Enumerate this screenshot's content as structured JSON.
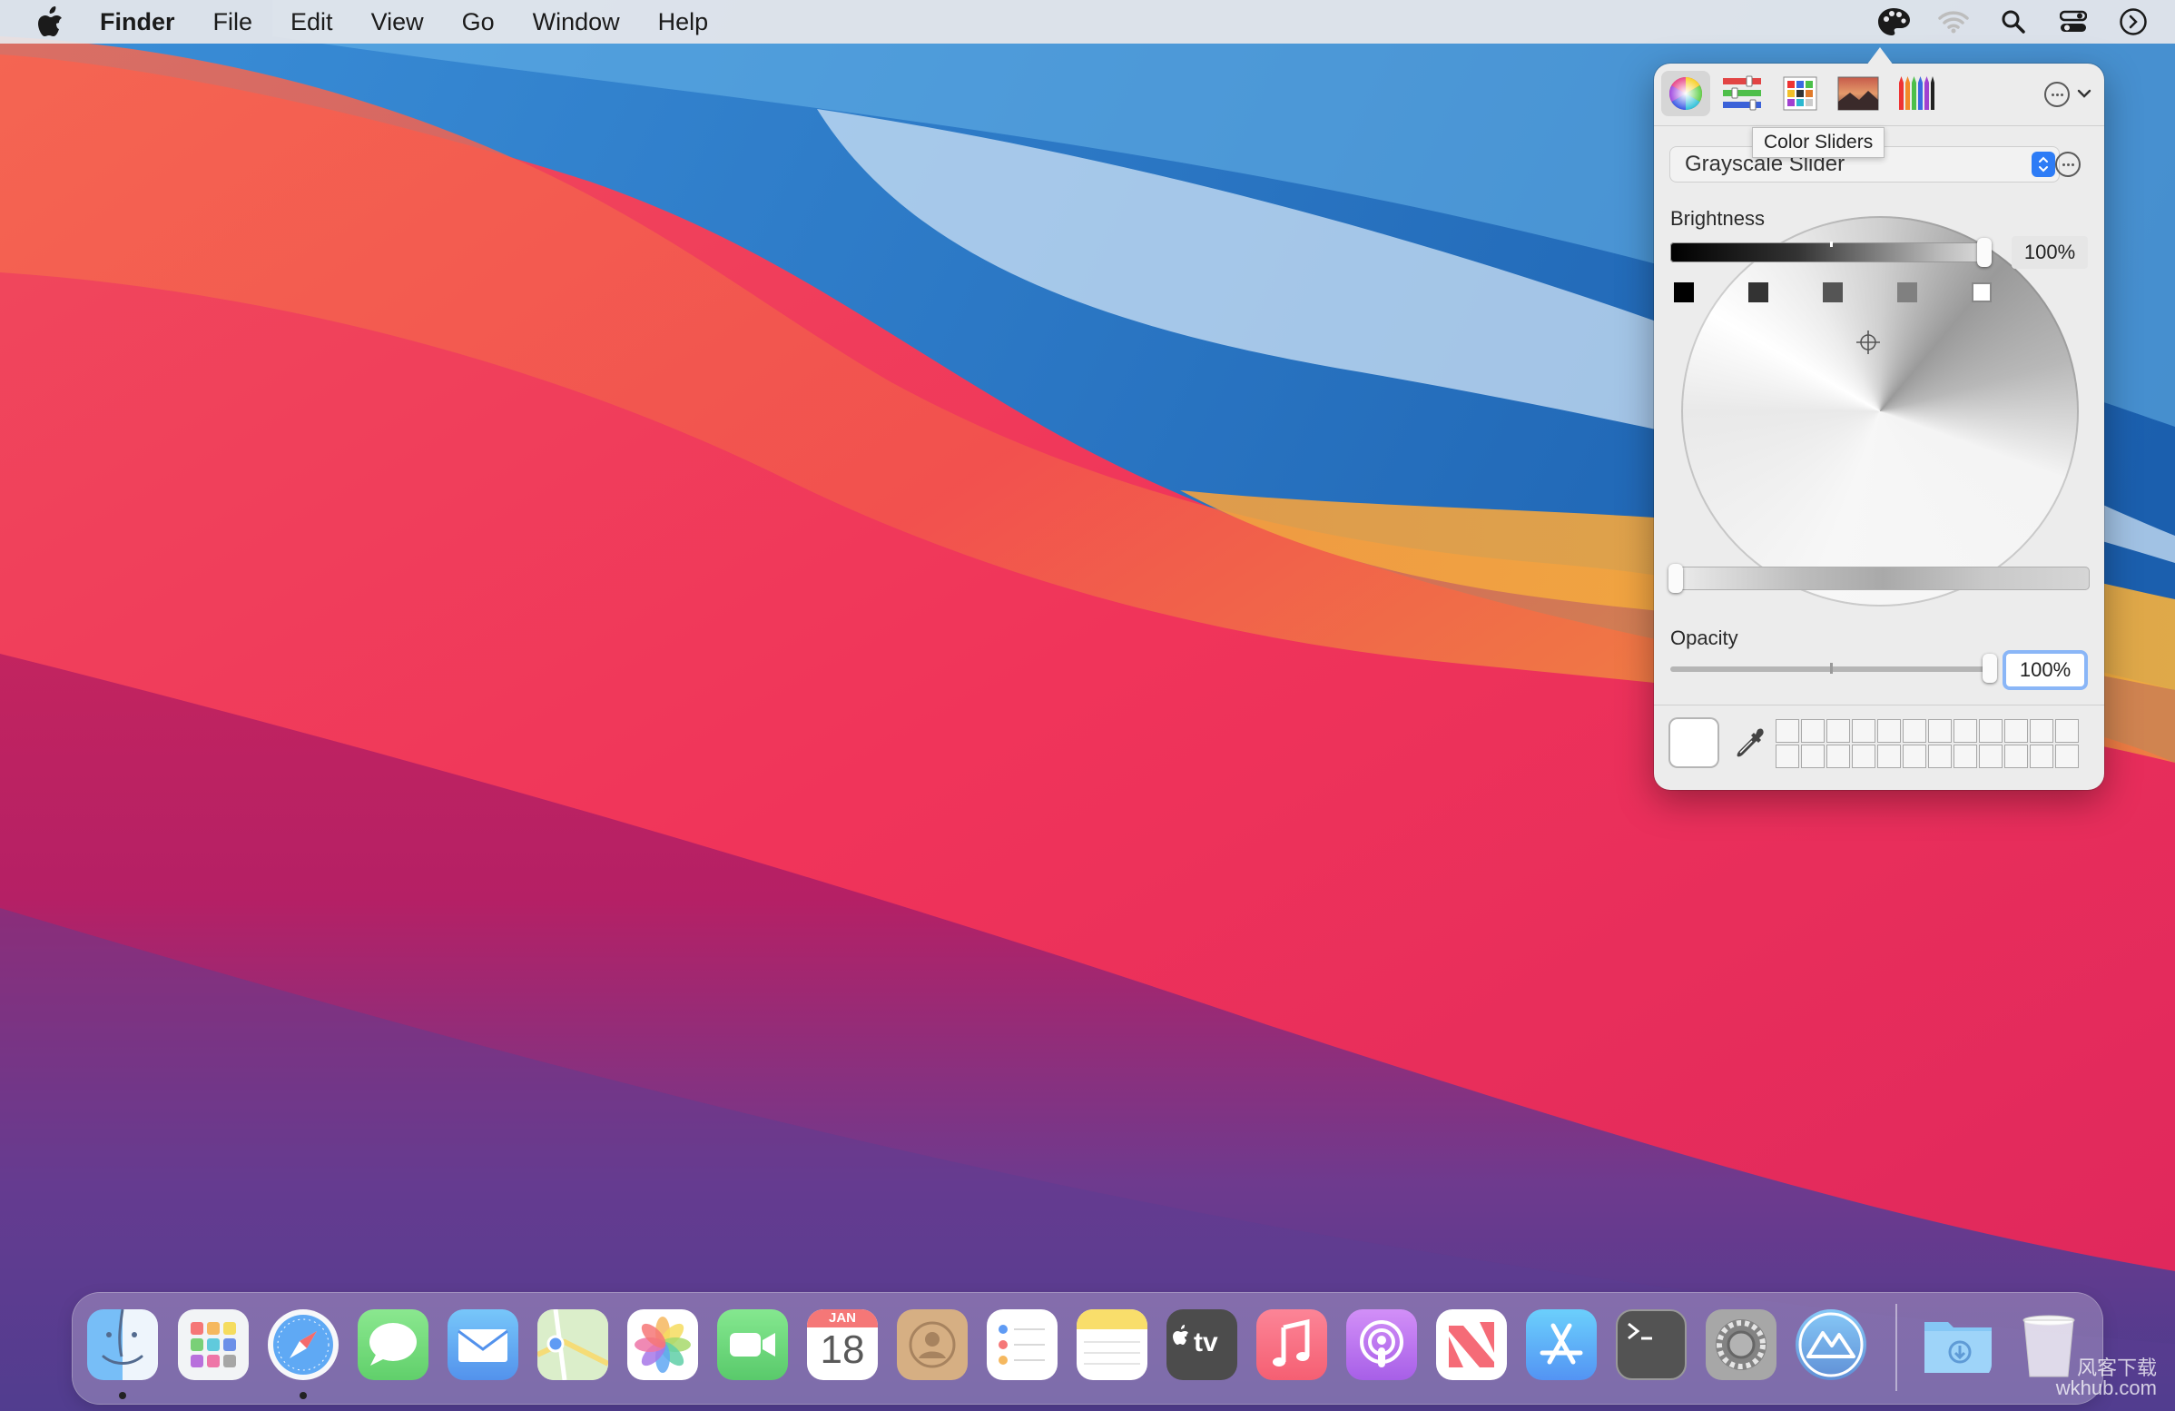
{
  "menubar": {
    "app_name": "Finder",
    "items": [
      "File",
      "Edit",
      "View",
      "Go",
      "Window",
      "Help"
    ],
    "right_icons": [
      "color-palette-icon",
      "wifi-icon",
      "spotlight-search-icon",
      "control-center-icon",
      "siri-icon"
    ]
  },
  "color_panel": {
    "toolbar_tabs": [
      "Color Wheel",
      "Color Sliders",
      "Color Palettes",
      "Image Palettes",
      "Pencils"
    ],
    "tooltip": "Color Sliders",
    "slider_mode": "Grayscale Slider",
    "brightness_label": "Brightness",
    "brightness_value": "100%",
    "brightness_level": 1.0,
    "opacity_label": "Opacity",
    "opacity_value": "100%",
    "opacity_level": 1.0,
    "gray_presets": [
      "#000000",
      "#333333",
      "#555555",
      "#808080",
      "#ffffff"
    ],
    "current_color": "#ffffff",
    "custom_swatch_count": 24
  },
  "dock": {
    "apps": [
      "Finder",
      "Launchpad",
      "Safari",
      "Messages",
      "Mail",
      "Maps",
      "Photos",
      "FaceTime",
      "Calendar",
      "Contacts",
      "Reminders",
      "Notes",
      "TV",
      "Music",
      "Podcasts",
      "News",
      "App Store",
      "Terminal",
      "System Preferences",
      "Monterey",
      "Downloads",
      "Trash"
    ],
    "calendar_month": "JAN",
    "calendar_day": "18",
    "tv_label": "tv",
    "running": [
      "Finder",
      "Safari"
    ]
  },
  "watermark": {
    "line1": "风客下载",
    "line2": "wkhub.com"
  },
  "colors": {
    "accent": "#2d7cf6",
    "focus_ring": "#8ab6f7"
  }
}
